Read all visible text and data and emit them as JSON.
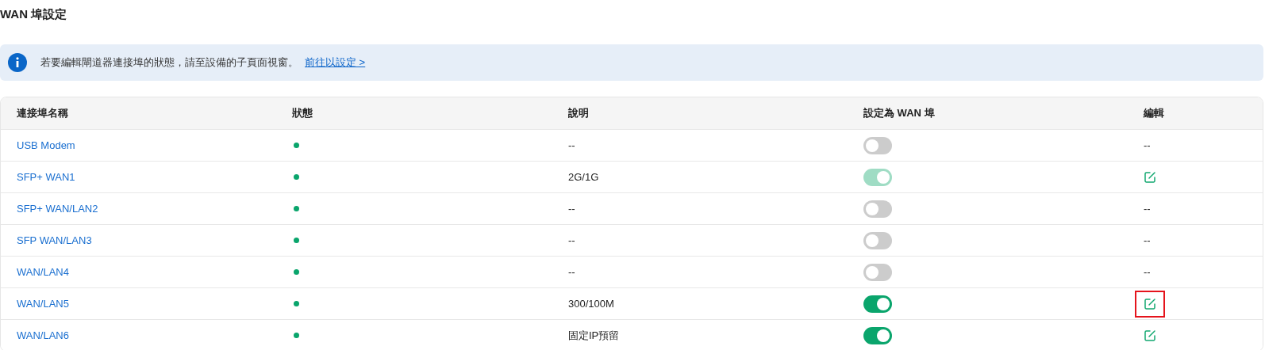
{
  "title": "WAN 埠設定",
  "notice": {
    "text": "若要編輯閘道器連接埠的狀態，請至設備的子頁面視窗。",
    "link": "前往以設定 >"
  },
  "table": {
    "columns": [
      "連接埠名稱",
      "狀態",
      "說明",
      "設定為 WAN 埠",
      "編輯"
    ],
    "rows": [
      {
        "name": "USB Modem",
        "description": "--",
        "wan": {
          "on": false,
          "disabled": false
        },
        "edit": {
          "kind": "text",
          "text": "--"
        },
        "highlighted": false
      },
      {
        "name": "SFP+ WAN1",
        "description": "2G/1G",
        "wan": {
          "on": true,
          "disabled": true
        },
        "edit": {
          "kind": "icon"
        },
        "highlighted": false
      },
      {
        "name": "SFP+ WAN/LAN2",
        "description": "--",
        "wan": {
          "on": false,
          "disabled": false
        },
        "edit": {
          "kind": "text",
          "text": "--"
        },
        "highlighted": false
      },
      {
        "name": "SFP WAN/LAN3",
        "description": "--",
        "wan": {
          "on": false,
          "disabled": false
        },
        "edit": {
          "kind": "text",
          "text": "--"
        },
        "highlighted": false
      },
      {
        "name": "WAN/LAN4",
        "description": "--",
        "wan": {
          "on": false,
          "disabled": false
        },
        "edit": {
          "kind": "text",
          "text": "--"
        },
        "highlighted": false
      },
      {
        "name": "WAN/LAN5",
        "description": "300/100M",
        "wan": {
          "on": true,
          "disabled": false
        },
        "edit": {
          "kind": "icon"
        },
        "highlighted": true
      },
      {
        "name": "WAN/LAN6",
        "description": "固定IP預留",
        "wan": {
          "on": true,
          "disabled": false
        },
        "edit": {
          "kind": "icon"
        },
        "highlighted": false
      }
    ]
  }
}
